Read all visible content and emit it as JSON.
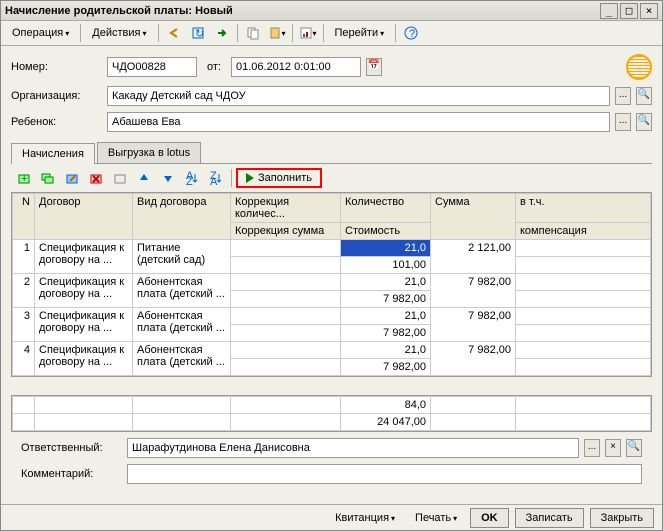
{
  "title": "Начисление родительской платы: Новый",
  "menu": {
    "operation": "Операция",
    "actions": "Действия",
    "goto": "Перейти"
  },
  "form": {
    "number_label": "Номер:",
    "number_value": "ЧДО00828",
    "from_label": "от:",
    "date_value": "01.06.2012  0:01:00",
    "org_label": "Организация:",
    "org_value": "Какаду Детский сад ЧДОУ",
    "child_label": "Ребенок:",
    "child_value": "Абашева Ева"
  },
  "tabs": {
    "accruals": "Начисления",
    "export": "Выгрузка в lotus"
  },
  "fill_btn": "Заполнить",
  "grid": {
    "headers": {
      "n": "N",
      "contract": "Договор",
      "contract_type": "Вид договора",
      "corr_qty": "Коррекция количес...",
      "corr_sum": "Коррекция сумма",
      "qty": "Количество",
      "cost": "Стоимость",
      "sum": "Сумма",
      "comp1": "в т.ч.",
      "comp2": "компенсация"
    },
    "rows": [
      {
        "n": 1,
        "contract": "Спецификация к договору на ...",
        "type": "Питание (детский сад)",
        "qty": "21,0",
        "cost": "101,00",
        "sum": "2 121,00"
      },
      {
        "n": 2,
        "contract": "Спецификация к договору на ...",
        "type": "Абонентская плата (детский ...",
        "qty": "21,0",
        "cost": "7 982,00",
        "sum": "7 982,00"
      },
      {
        "n": 3,
        "contract": "Спецификация к договору на ...",
        "type": "Абонентская плата (детский ...",
        "qty": "21,0",
        "cost": "7 982,00",
        "sum": "7 982,00"
      },
      {
        "n": 4,
        "contract": "Спецификация к договору на ...",
        "type": "Абонентская плата (детский ...",
        "qty": "21,0",
        "cost": "7 982,00",
        "sum": "7 982,00"
      }
    ],
    "totals": {
      "qty": "84,0",
      "cost": "24 047,00"
    }
  },
  "bottom": {
    "resp_label": "Ответственный:",
    "resp_value": "Шарафутдинова Елена Данисовна",
    "comment_label": "Комментарий:",
    "comment_value": ""
  },
  "footer": {
    "receipt": "Квитанция",
    "print": "Печать",
    "ok": "OK",
    "save": "Записать",
    "close": "Закрыть"
  }
}
